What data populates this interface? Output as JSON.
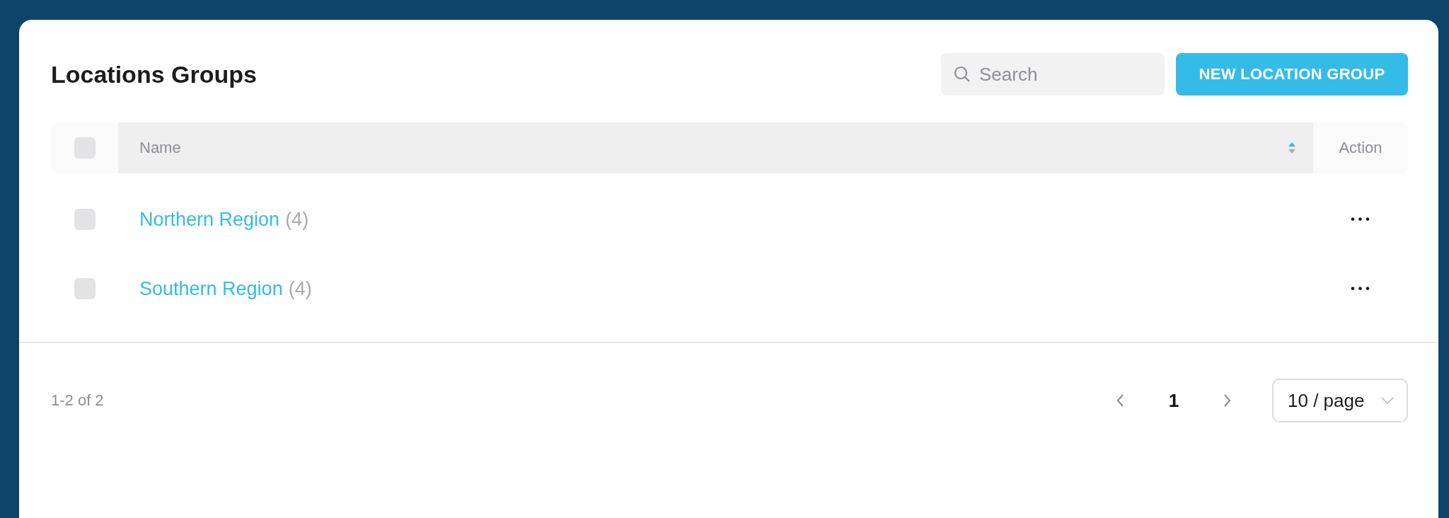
{
  "title": "Locations Groups",
  "search": {
    "placeholder": "Search"
  },
  "new_button": "NEW LOCATION GROUP",
  "table": {
    "select_all": {
      "checked": false
    },
    "columns": [
      {
        "label": "Name",
        "sortable": true
      },
      {
        "label": "Action",
        "sortable": false
      }
    ],
    "rows": [
      {
        "name": "Northern Region",
        "count": "(4)",
        "checked": false,
        "action": "•••"
      },
      {
        "name": "Southern Region",
        "count": "(4)",
        "checked": false,
        "action": "•••"
      }
    ]
  },
  "footer": {
    "range": "1-2 of 2",
    "pages": [
      {
        "label": "1",
        "selected": true
      }
    ],
    "page_size": "10 / page"
  }
}
